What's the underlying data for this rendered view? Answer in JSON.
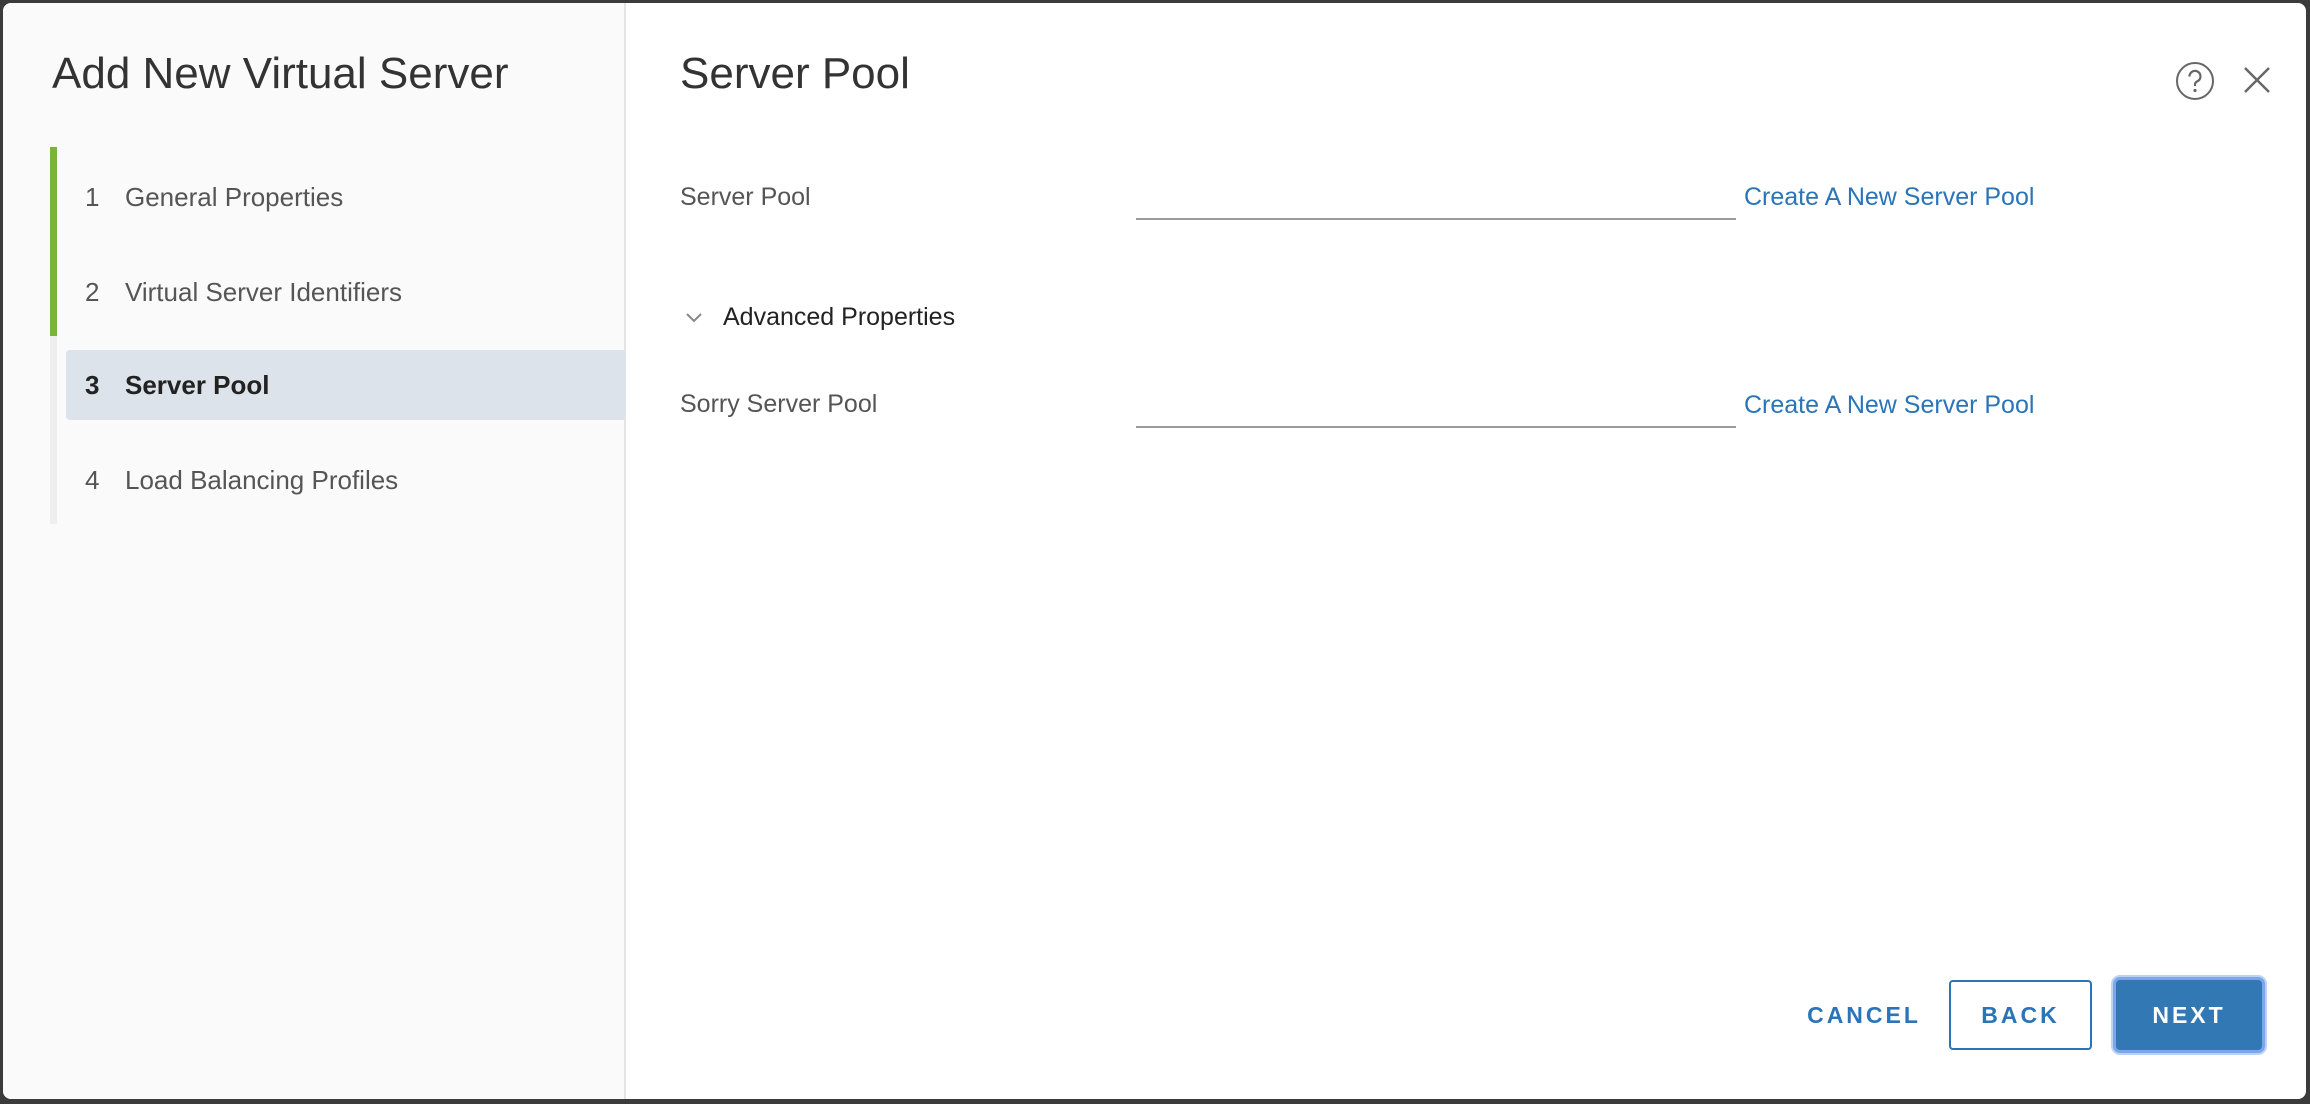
{
  "wizard": {
    "title": "Add New Virtual Server",
    "steps": [
      {
        "num": "1",
        "label": "General Properties",
        "state": "complete"
      },
      {
        "num": "2",
        "label": "Virtual Server Identifiers",
        "state": "complete"
      },
      {
        "num": "3",
        "label": "Server Pool",
        "state": "active"
      },
      {
        "num": "4",
        "label": "Load Balancing Profiles",
        "state": "pending"
      }
    ]
  },
  "page": {
    "heading": "Server Pool",
    "server_pool": {
      "label": "Server Pool",
      "value": "",
      "link": "Create A New Server Pool"
    },
    "advanced": {
      "label": "Advanced Properties",
      "expanded": true
    },
    "sorry_pool": {
      "label": "Sorry Server Pool",
      "value": "",
      "link": "Create A New Server Pool"
    }
  },
  "footer": {
    "cancel": "CANCEL",
    "back": "BACK",
    "next": "NEXT"
  },
  "colors": {
    "accent": "#2b74b7",
    "progress": "#79b43a",
    "primary": "#3278b4"
  }
}
